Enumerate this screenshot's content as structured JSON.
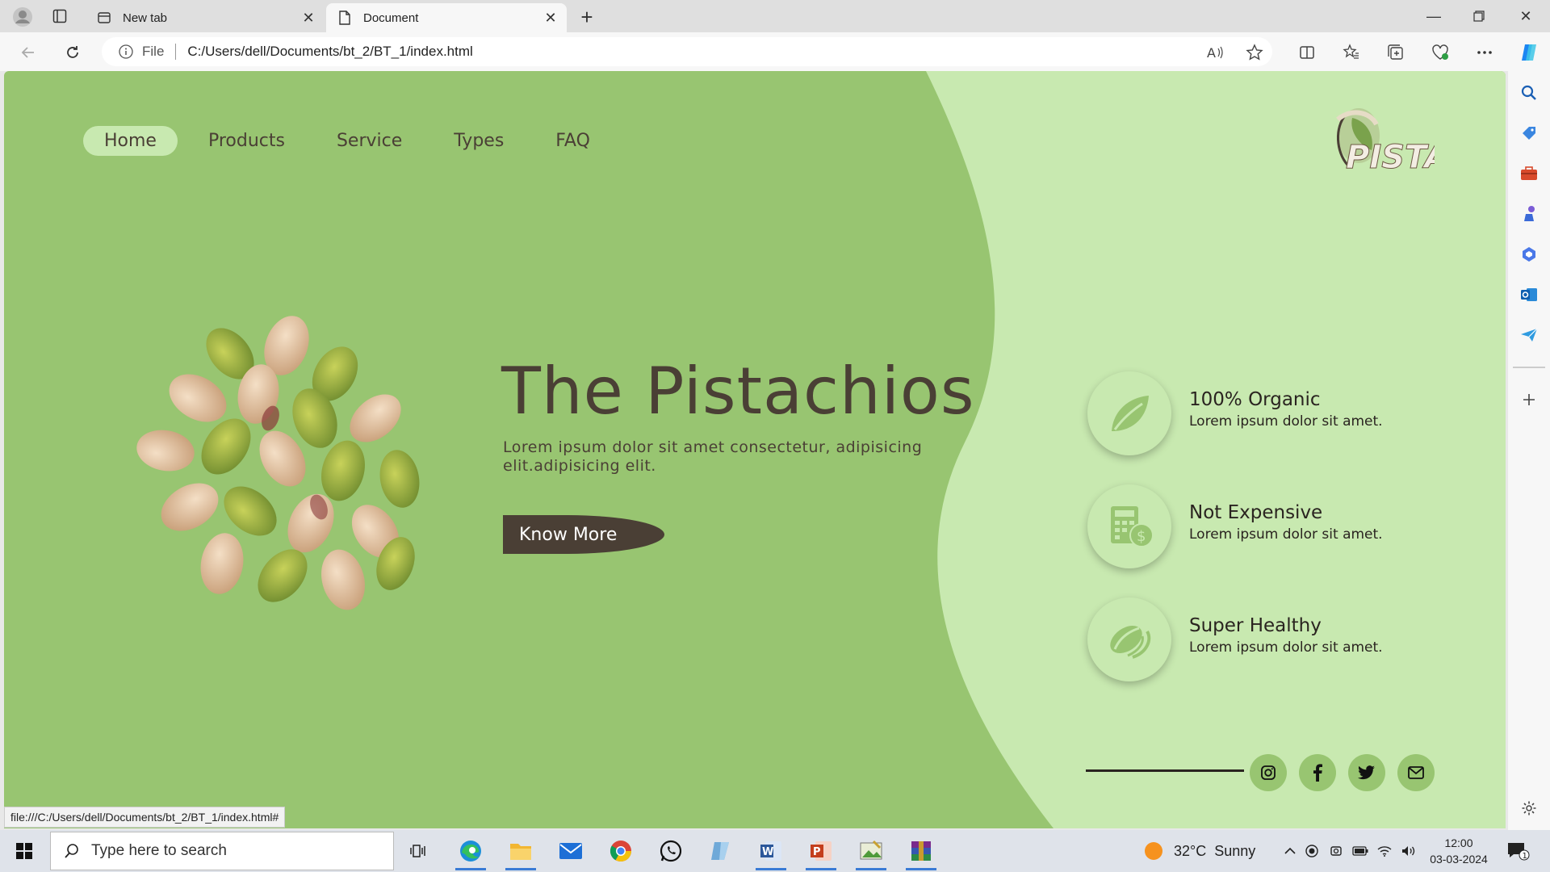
{
  "browser": {
    "tabs": [
      {
        "title": "New tab",
        "active": false
      },
      {
        "title": "Document",
        "active": true
      }
    ],
    "address": {
      "scheme_label": "File",
      "url": "C:/Users/dell/Documents/bt_2/BT_1/index.html"
    },
    "status_url": "file:///C:/Users/dell/Documents/bt_2/BT_1/index.html#"
  },
  "page": {
    "nav": {
      "items": [
        "Home",
        "Products",
        "Service",
        "Types",
        "FAQ"
      ],
      "active": "Home"
    },
    "logo_text": "PISTA",
    "hero": {
      "title": "The Pistachios",
      "text": "Lorem ipsum dolor sit amet consectetur, adipisicing elit.adipisicing elit.",
      "button": "Know More"
    },
    "features": [
      {
        "title": "100% Organic",
        "desc": "Lorem ipsum dolor sit amet.",
        "icon": "leaf-icon"
      },
      {
        "title": "Not Expensive",
        "desc": "Lorem ipsum dolor sit amet.",
        "icon": "calculator-money-icon"
      },
      {
        "title": "Super Healthy",
        "desc": "Lorem ipsum dolor sit amet.",
        "icon": "pistachio-icon"
      }
    ],
    "social": [
      "instagram-icon",
      "facebook-icon",
      "twitter-icon",
      "mail-icon"
    ],
    "colors": {
      "primary_green": "#98c571",
      "light_green": "#c8e9b0",
      "dark_brown": "#4a3f35"
    }
  },
  "taskbar": {
    "search_placeholder": "Type here to search",
    "weather": {
      "temp": "32°C",
      "condition": "Sunny"
    },
    "time": "12:00",
    "date": "03-03-2024",
    "notification_count": "1"
  }
}
